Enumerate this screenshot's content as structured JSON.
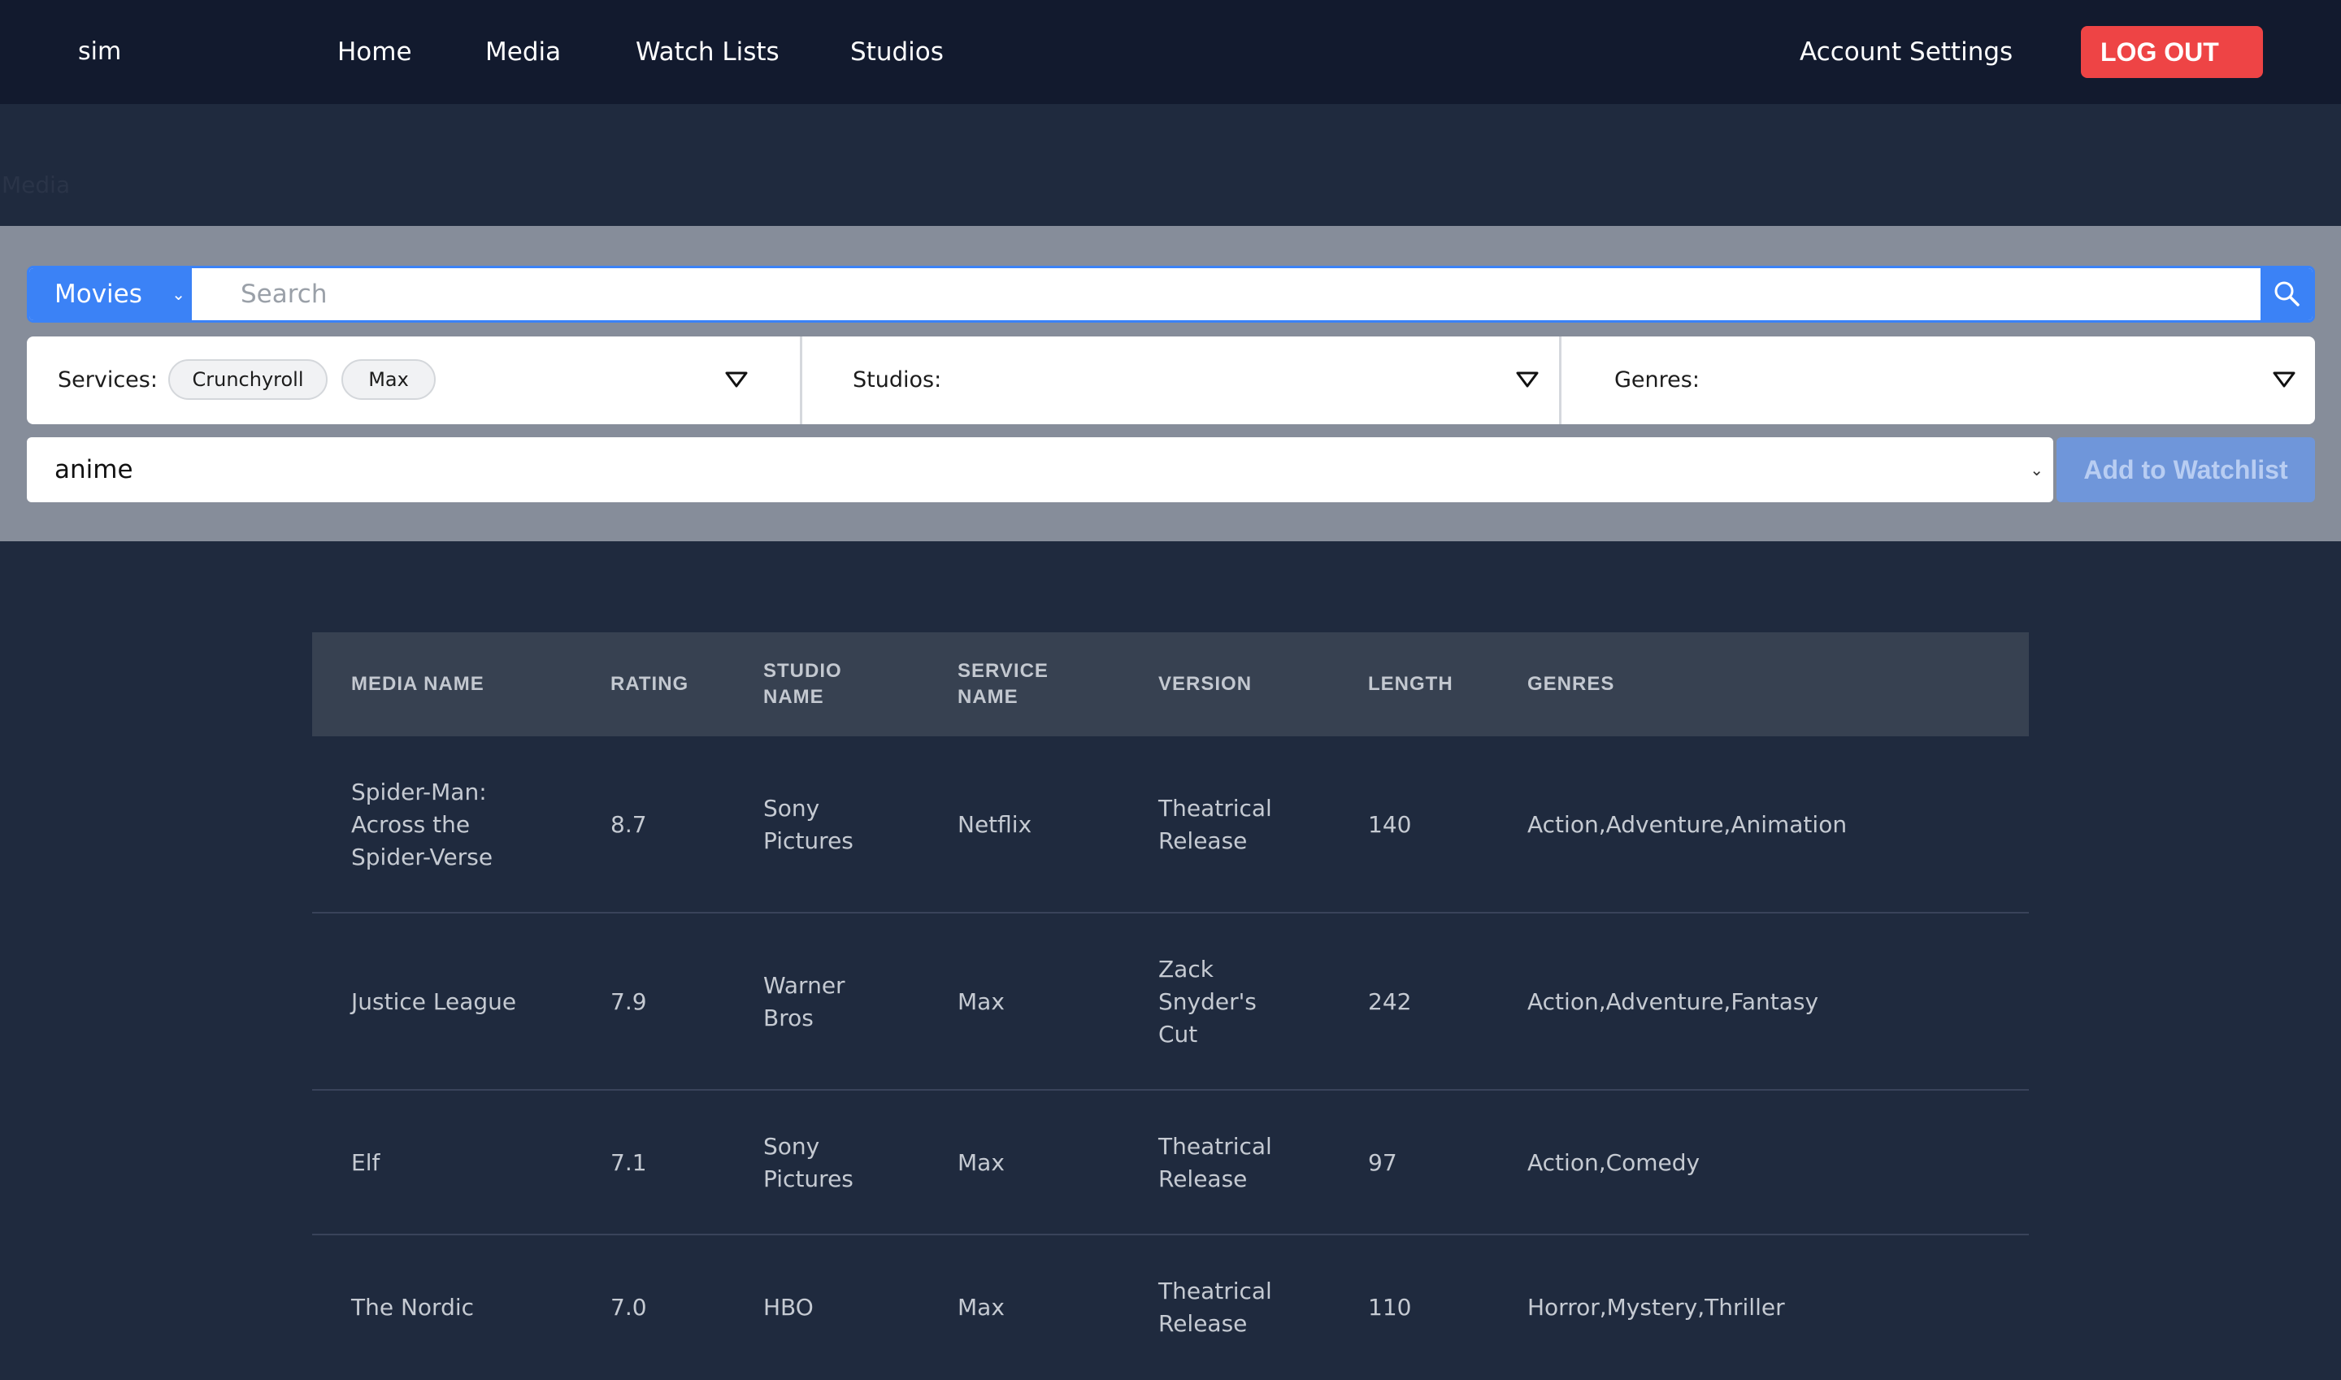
{
  "nav": {
    "brand": "sim",
    "links": [
      "Home",
      "Media",
      "Watch Lists",
      "Studios"
    ],
    "account": "Account Settings",
    "logout": "LOG OUT"
  },
  "page": {
    "label": "Media"
  },
  "search": {
    "type": "Movies",
    "placeholder": "Search"
  },
  "filters": {
    "services_label": "Services:",
    "services_selected": [
      "Crunchyroll",
      "Max"
    ],
    "studios_label": "Studios:",
    "genres_label": "Genres:"
  },
  "watchlist": {
    "selected": "anime",
    "add_label": "Add to Watchlist"
  },
  "table": {
    "headers": {
      "name": [
        "MEDIA NAME"
      ],
      "rating": [
        "RATING"
      ],
      "studio": [
        "STUDIO",
        "NAME"
      ],
      "service": [
        "SERVICE",
        "NAME"
      ],
      "version": [
        "VERSION"
      ],
      "length": [
        "LENGTH"
      ],
      "genres": [
        "GENRES"
      ]
    },
    "rows": [
      {
        "name": [
          "Spider-Man:",
          "Across the",
          "Spider-Verse"
        ],
        "rating": "8.7",
        "studio": [
          "Sony",
          "Pictures"
        ],
        "service": "Netflix",
        "version": [
          "Theatrical",
          "Release"
        ],
        "length": "140",
        "genres": "Action,Adventure,Animation"
      },
      {
        "name": [
          "Justice League"
        ],
        "rating": "7.9",
        "studio": [
          "Warner",
          "Bros"
        ],
        "service": "Max",
        "version": [
          "Zack",
          "Snyder's",
          "Cut"
        ],
        "length": "242",
        "genres": "Action,Adventure,Fantasy"
      },
      {
        "name": [
          "Elf"
        ],
        "rating": "7.1",
        "studio": [
          "Sony",
          "Pictures"
        ],
        "service": "Max",
        "version": [
          "Theatrical",
          "Release"
        ],
        "length": "97",
        "genres": "Action,Comedy"
      },
      {
        "name": [
          "The Nordic"
        ],
        "rating": "7.0",
        "studio": [
          "HBO"
        ],
        "service": "Max",
        "version": [
          "Theatrical",
          "Release"
        ],
        "length": "110",
        "genres": "Horror,Mystery,Thriller"
      }
    ]
  },
  "colors": {
    "nav_bg": "#121a2e",
    "page_bg": "#1f2a3e",
    "panel_bg": "#868d9a",
    "accent": "#3b82f6",
    "logout": "#ee4445",
    "table_head": "#374151"
  }
}
